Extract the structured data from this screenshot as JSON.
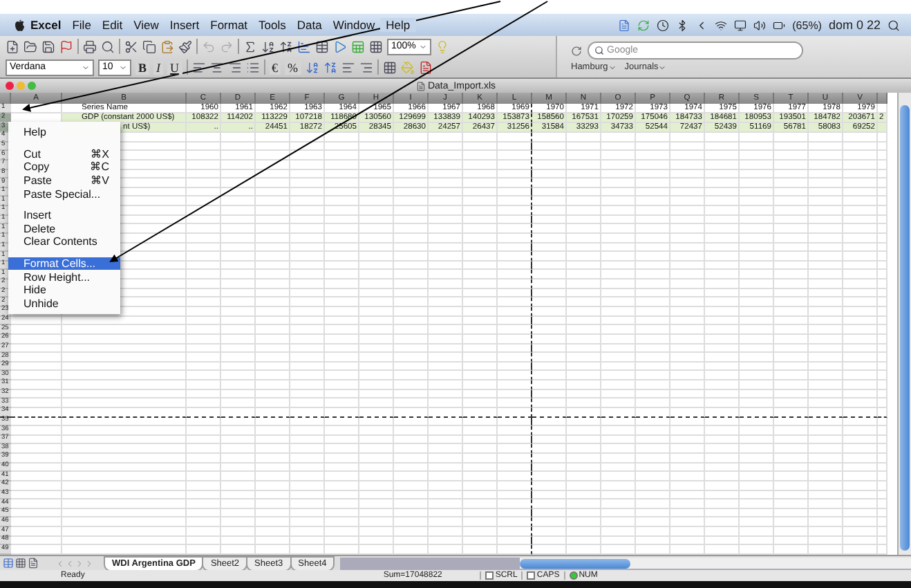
{
  "menu_bar": {
    "items": [
      "Excel",
      "File",
      "Edit",
      "View",
      "Insert",
      "Format",
      "Tools",
      "Data",
      "Window",
      "Help"
    ],
    "battery": "(65%)",
    "clock": "dom 0 22"
  },
  "standard_toolbar": {
    "zoom": "100%"
  },
  "formatting_toolbar": {
    "font": "Verdana",
    "size": "10",
    "style_buttons": [
      "B",
      "I",
      "U"
    ],
    "number_buttons": [
      "€",
      "%"
    ]
  },
  "browser": {
    "search_placeholder": "Google",
    "bookmarks": [
      "Hamburg",
      "Journals"
    ]
  },
  "window": {
    "title": "Data_Import.xls"
  },
  "sheet": {
    "columns": [
      "A",
      "B",
      "C",
      "D",
      "E",
      "F",
      "G",
      "H",
      "I",
      "J",
      "K",
      "L",
      "M",
      "N",
      "O",
      "P",
      "Q",
      "R",
      "S",
      "T",
      "U",
      "V"
    ],
    "rows": [
      {
        "number": "1",
        "selected": false,
        "label": "Series Name",
        "values": [
          "1960",
          "1961",
          "1962",
          "1963",
          "1964",
          "1965",
          "1966",
          "1967",
          "1968",
          "1969",
          "1970",
          "1971",
          "1972",
          "1973",
          "1974",
          "1975",
          "1976",
          "1977",
          "1978",
          "1979"
        ]
      },
      {
        "number": "2",
        "selected": true,
        "label": "GDP (constant 2000 US$)",
        "values": [
          "108322",
          "114202",
          "113229",
          "107218",
          "118680",
          "130560",
          "129699",
          "133839",
          "140293",
          "153873",
          "158560",
          "167531",
          "170259",
          "175046",
          "184733",
          "184681",
          "180953",
          "193501",
          "184782",
          "203671",
          "2"
        ]
      },
      {
        "number": "3",
        "selected": true,
        "label": "nt US$)",
        "values": [
          "..",
          "..",
          "24451",
          "18272",
          "25605",
          "28345",
          "28630",
          "24257",
          "26437",
          "31256",
          "31584",
          "33293",
          "34733",
          "52544",
          "72437",
          "52439",
          "51169",
          "56781",
          "58083",
          "69252"
        ]
      },
      {
        "number": "4",
        "selected": false
      },
      {
        "number": "5",
        "selected": false
      },
      {
        "number": "6",
        "selected": false
      },
      {
        "number": "7",
        "selected": false
      },
      {
        "number": "8",
        "selected": false
      },
      {
        "number": "9",
        "selected": false
      },
      {
        "number": "1",
        "selected": false
      },
      {
        "number": "1",
        "selected": false
      },
      {
        "number": "1",
        "selected": false
      },
      {
        "number": "1",
        "selected": false
      },
      {
        "number": "1",
        "selected": false
      },
      {
        "number": "1",
        "selected": false
      },
      {
        "number": "1",
        "selected": false
      },
      {
        "number": "1",
        "selected": false
      },
      {
        "number": "1",
        "selected": false
      },
      {
        "number": "1",
        "selected": false
      },
      {
        "number": "2",
        "selected": false
      },
      {
        "number": "2",
        "selected": false
      },
      {
        "number": "2",
        "selected": false
      },
      {
        "number": "23",
        "selected": false
      },
      {
        "number": "24",
        "selected": false
      },
      {
        "number": "25",
        "selected": false
      },
      {
        "number": "26",
        "selected": false
      },
      {
        "number": "27",
        "selected": false
      },
      {
        "number": "28",
        "selected": false
      },
      {
        "number": "29",
        "selected": false
      },
      {
        "number": "30",
        "selected": false
      },
      {
        "number": "31",
        "selected": false
      },
      {
        "number": "32",
        "selected": false
      },
      {
        "number": "33",
        "selected": false
      },
      {
        "number": "34",
        "selected": false
      },
      {
        "number": "35",
        "selected": false
      },
      {
        "number": "36",
        "selected": false
      },
      {
        "number": "37",
        "selected": false
      },
      {
        "number": "38",
        "selected": false
      },
      {
        "number": "39",
        "selected": false
      },
      {
        "number": "40",
        "selected": false
      },
      {
        "number": "41",
        "selected": false
      },
      {
        "number": "42",
        "selected": false
      },
      {
        "number": "43",
        "selected": false
      },
      {
        "number": "44",
        "selected": false
      },
      {
        "number": "45",
        "selected": false
      },
      {
        "number": "46",
        "selected": false
      },
      {
        "number": "47",
        "selected": false
      },
      {
        "number": "48",
        "selected": false
      },
      {
        "number": "49",
        "selected": false
      }
    ]
  },
  "context_menu": {
    "groups": [
      [
        {
          "label": "Help",
          "selected": false
        }
      ],
      [
        {
          "label": "Cut",
          "shortcut": "⌘X",
          "selected": false
        },
        {
          "label": "Copy",
          "shortcut": "⌘C",
          "selected": false
        },
        {
          "label": "Paste",
          "shortcut": "⌘V",
          "selected": false
        },
        {
          "label": "Paste Special...",
          "selected": false
        }
      ],
      [
        {
          "label": "Insert",
          "selected": false
        },
        {
          "label": "Delete",
          "selected": false
        },
        {
          "label": "Clear Contents",
          "selected": false
        }
      ],
      [
        {
          "label": "Format Cells...",
          "selected": true
        },
        {
          "label": "Row Height...",
          "selected": false
        },
        {
          "label": "Hide",
          "selected": false
        },
        {
          "label": "Unhide",
          "selected": false
        }
      ]
    ]
  },
  "sheet_tabs": [
    {
      "label": "WDI Argentina GDP",
      "selected": true
    },
    {
      "label": "Sheet2",
      "selected": false
    },
    {
      "label": "Sheet3",
      "selected": false
    },
    {
      "label": "Sheet4",
      "selected": false
    }
  ],
  "status_bar": {
    "mode": "Ready",
    "sum": "Sum=17048822",
    "indicators": [
      {
        "label": "SCRL",
        "on": false
      },
      {
        "label": "CAPS",
        "on": false
      },
      {
        "label": "NUM",
        "on": true
      }
    ]
  }
}
